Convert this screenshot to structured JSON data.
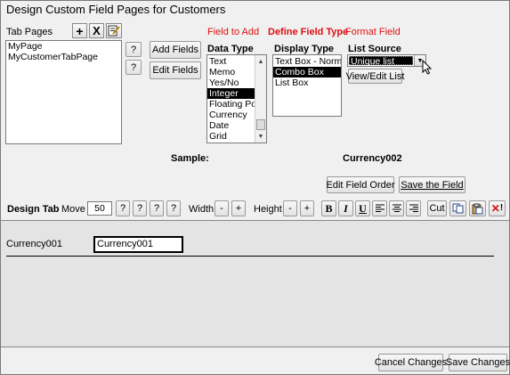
{
  "window": {
    "title": "Design Custom Field Pages for Customers"
  },
  "tab_pages": {
    "label": "Tab Pages",
    "items": [
      {
        "label": "MyPage",
        "selected": true
      },
      {
        "label": "MyCustomerTabPage",
        "selected": false
      }
    ],
    "tools": {
      "add": "+",
      "remove": "X"
    }
  },
  "help": "?",
  "buttons": {
    "add_fields": "Add Fields",
    "edit_fields": "Edit Fields",
    "view_edit_list": "View/Edit List",
    "edit_field_order": "Edit Field Order",
    "save_field": "Save the Field",
    "cancel_changes": "Cancel Changes",
    "save_changes": "Save Changes"
  },
  "steps": {
    "field_to_add": "Field to Add",
    "define_field_type": "Define Field Type",
    "format_field": "Format Field"
  },
  "data_type": {
    "label": "Data Type",
    "items": [
      {
        "label": "Text",
        "selected": false
      },
      {
        "label": "Memo",
        "selected": false
      },
      {
        "label": "Yes/No",
        "selected": false
      },
      {
        "label": "Integer",
        "selected": true
      },
      {
        "label": "Floating Point",
        "selected": false
      },
      {
        "label": "Currency",
        "selected": false
      },
      {
        "label": "Date",
        "selected": false
      },
      {
        "label": "Grid",
        "selected": false
      }
    ]
  },
  "display_type": {
    "label": "Display Type",
    "items": [
      {
        "label": "Text Box - Normal",
        "selected": false
      },
      {
        "label": "Combo Box",
        "selected": true
      },
      {
        "label": "List Box",
        "selected": false
      }
    ]
  },
  "list_source": {
    "label": "List Source",
    "value": "Unique list"
  },
  "sample": {
    "label": "Sample:",
    "value": "Currency002"
  },
  "design_toolbar": {
    "label": "Design Tab",
    "move": {
      "label": "Move",
      "value": "50"
    },
    "width": {
      "label": "Width",
      "minus": "-",
      "plus": "+"
    },
    "height": {
      "label": "Height",
      "minus": "-",
      "plus": "+"
    },
    "bold": "B",
    "italic": "I",
    "underline": "U",
    "cut": "Cut"
  },
  "design_canvas": {
    "field_label": "Currency001",
    "field_value": "Currency001"
  },
  "icons": {
    "arrow_up": "▲",
    "arrow_down": "▼",
    "delete_x": "✕"
  }
}
